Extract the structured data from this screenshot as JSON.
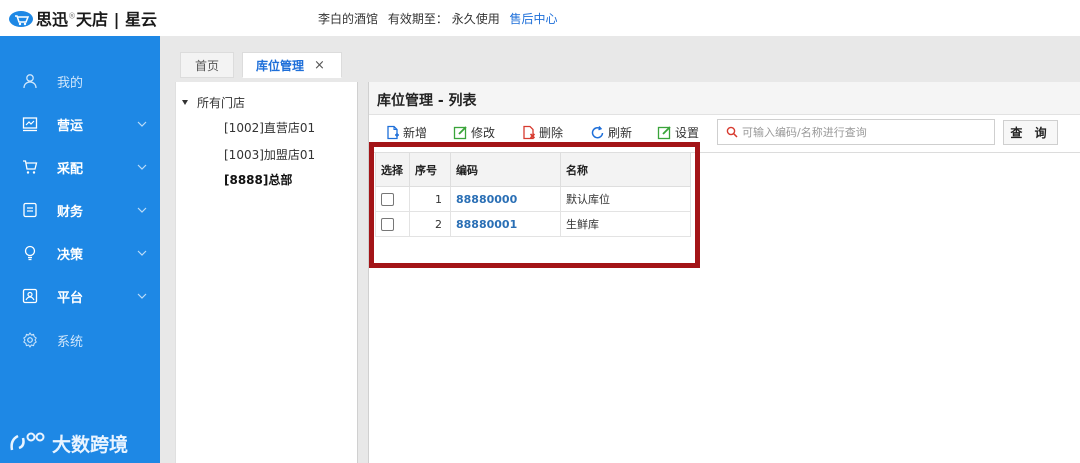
{
  "header": {
    "logo_text": "思迅",
    "logo_sup": "®",
    "logo_rest": "天店 | 星云",
    "store_name": "李白的酒馆",
    "validity_label": "有效期至：",
    "validity_value": "永久使用",
    "service_link": "售后中心"
  },
  "sidebar": {
    "items": [
      {
        "label": "我的",
        "icon": "user-icon",
        "expandable": false
      },
      {
        "label": "营运",
        "icon": "chart-icon",
        "expandable": true
      },
      {
        "label": "采配",
        "icon": "cart-icon",
        "expandable": true
      },
      {
        "label": "财务",
        "icon": "finance-icon",
        "expandable": true
      },
      {
        "label": "决策",
        "icon": "bulb-icon",
        "expandable": true
      },
      {
        "label": "平台",
        "icon": "platform-icon",
        "expandable": true
      },
      {
        "label": "系统",
        "icon": "gear-icon",
        "expandable": false
      }
    ],
    "brand": "大数跨境",
    "color": "#1e88e5"
  },
  "tabs": [
    {
      "label": "首页"
    },
    {
      "label": "库位管理",
      "close": "×"
    }
  ],
  "tree": {
    "root": "所有门店",
    "nodes": [
      "[1002]直营店01",
      "[1003]加盟店01",
      "[8888]总部"
    ]
  },
  "main": {
    "title": "库位管理 - 列表",
    "toolbar": {
      "add": "新增",
      "edit": "修改",
      "delete": "删除",
      "refresh": "刷新",
      "settings": "设置"
    },
    "search": {
      "placeholder": "可输入编码/名称进行查询",
      "button": "查 询"
    },
    "table": {
      "headers": [
        "选择",
        "序号",
        "编码",
        "名称"
      ],
      "rows": [
        {
          "index": "1",
          "code": "88880000",
          "name": "默认库位"
        },
        {
          "index": "2",
          "code": "88880001",
          "name": "生鲜库"
        }
      ]
    }
  },
  "colors": {
    "accent": "#1e6fd9",
    "highlight_border": "#a31417"
  }
}
